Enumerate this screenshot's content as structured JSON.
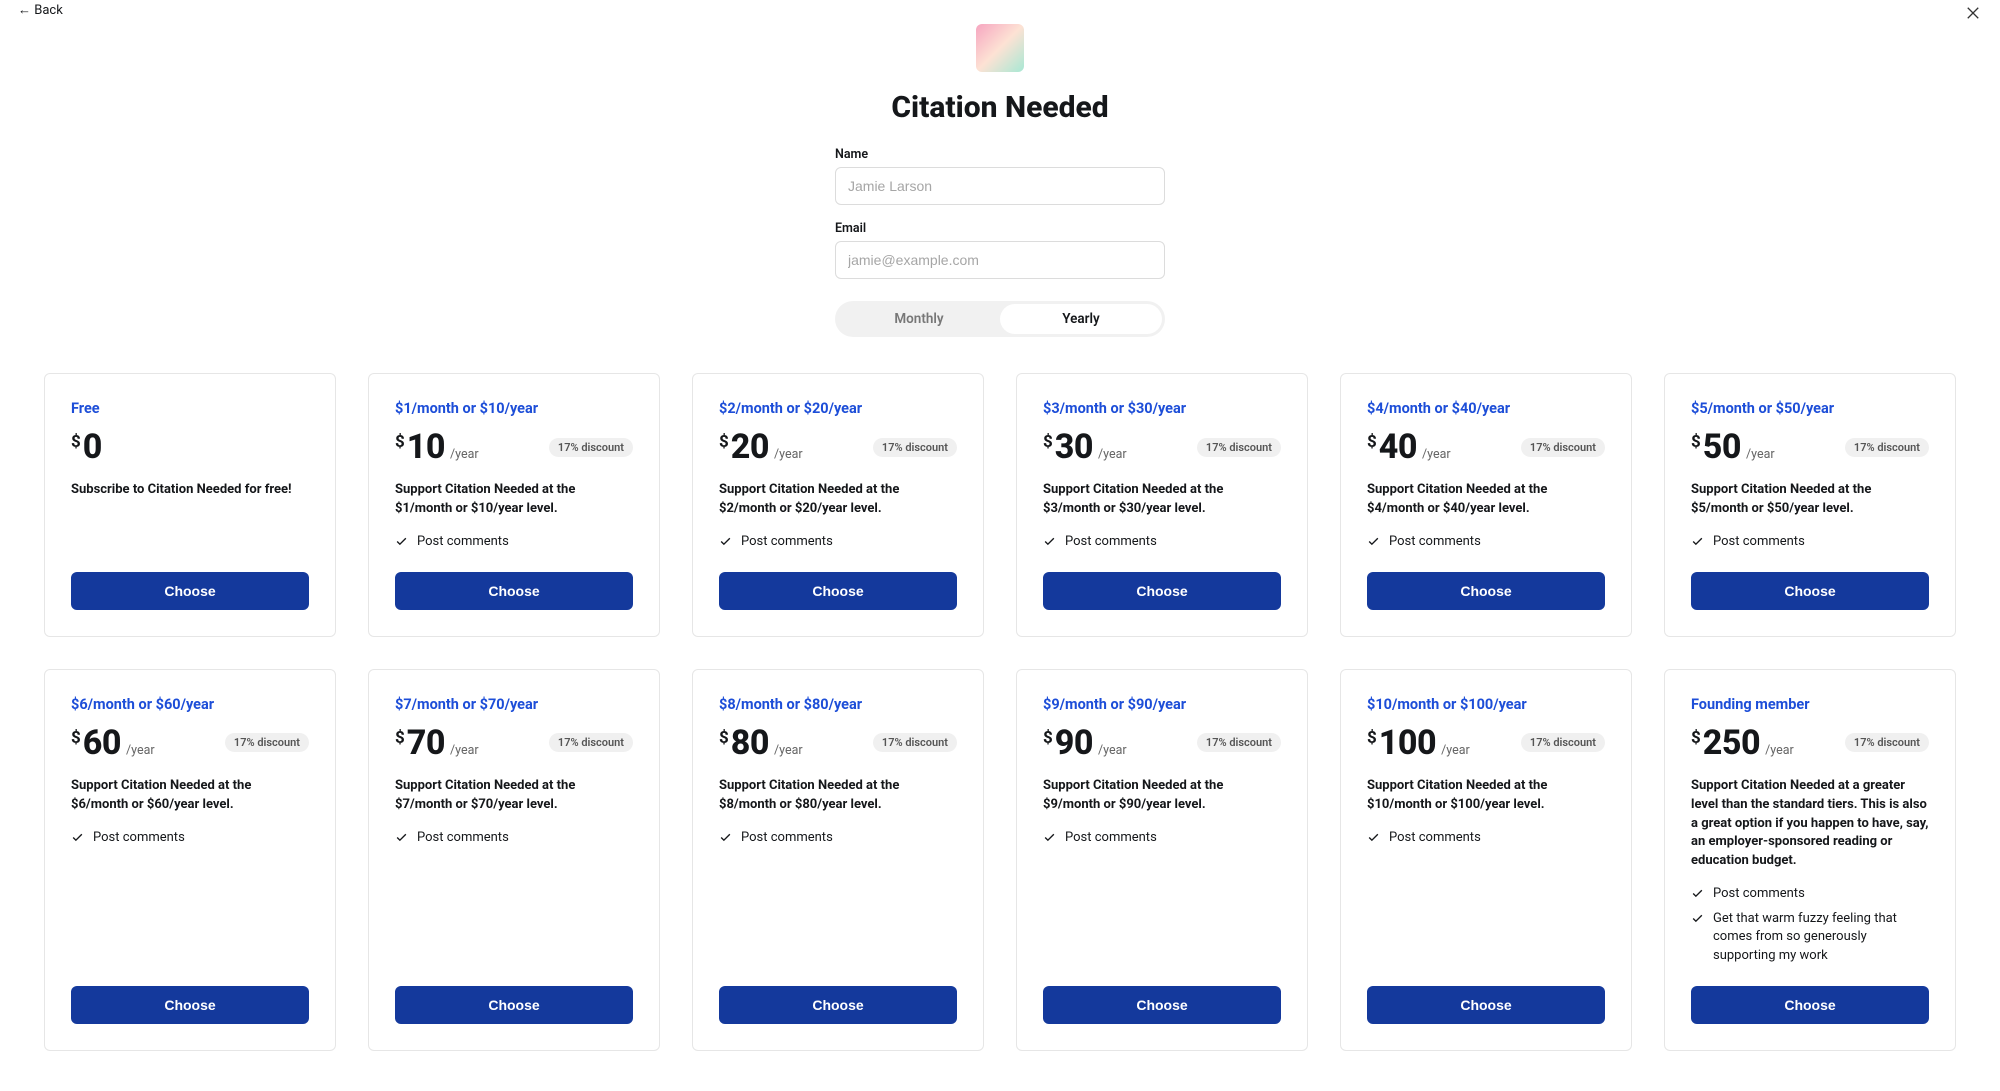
{
  "back_label": "← Back",
  "title": "Citation Needed",
  "form": {
    "name_label": "Name",
    "name_placeholder": "Jamie Larson",
    "email_label": "Email",
    "email_placeholder": "jamie@example.com"
  },
  "toggle": {
    "monthly": "Monthly",
    "yearly": "Yearly"
  },
  "discount_label": "17% discount",
  "choose_label": "Choose",
  "feature_comments": "Post comments",
  "feature_fuzzy": "Get that warm fuzzy feeling that comes from so generously supporting my work",
  "plans": [
    {
      "title": "Free",
      "amount": "0",
      "per": "",
      "discount": false,
      "desc": "Subscribe to Citation Needed for free!",
      "features": []
    },
    {
      "title": "$1/month or $10/year",
      "amount": "10",
      "per": "/year",
      "discount": true,
      "desc": "Support Citation Needed at the $1/month or $10/year level.",
      "features": [
        "comments"
      ]
    },
    {
      "title": "$2/month or $20/year",
      "amount": "20",
      "per": "/year",
      "discount": true,
      "desc": "Support Citation Needed at the $2/month or $20/year level.",
      "features": [
        "comments"
      ]
    },
    {
      "title": "$3/month or $30/year",
      "amount": "30",
      "per": "/year",
      "discount": true,
      "desc": "Support Citation Needed at the $3/month or $30/year level.",
      "features": [
        "comments"
      ]
    },
    {
      "title": "$4/month or $40/year",
      "amount": "40",
      "per": "/year",
      "discount": true,
      "desc": "Support Citation Needed at the $4/month or $40/year level.",
      "features": [
        "comments"
      ]
    },
    {
      "title": "$5/month or $50/year",
      "amount": "50",
      "per": "/year",
      "discount": true,
      "desc": "Support Citation Needed at the $5/month or $50/year level.",
      "features": [
        "comments"
      ]
    },
    {
      "title": "$6/month or $60/year",
      "amount": "60",
      "per": "/year",
      "discount": true,
      "desc": "Support Citation Needed at the $6/month or $60/year level.",
      "features": [
        "comments"
      ]
    },
    {
      "title": "$7/month or $70/year",
      "amount": "70",
      "per": "/year",
      "discount": true,
      "desc": "Support Citation Needed at the $7/month or $70/year level.",
      "features": [
        "comments"
      ]
    },
    {
      "title": "$8/month or $80/year",
      "amount": "80",
      "per": "/year",
      "discount": true,
      "desc": "Support Citation Needed at the $8/month or $80/year level.",
      "features": [
        "comments"
      ]
    },
    {
      "title": "$9/month or $90/year",
      "amount": "90",
      "per": "/year",
      "discount": true,
      "desc": "Support Citation Needed at the $9/month or $90/year level.",
      "features": [
        "comments"
      ]
    },
    {
      "title": "$10/month or $100/year",
      "amount": "100",
      "per": "/year",
      "discount": true,
      "desc": "Support Citation Needed at the $10/month or $100/year level.",
      "features": [
        "comments"
      ]
    },
    {
      "title": "Founding member",
      "amount": "250",
      "per": "/year",
      "discount": true,
      "desc": "Support Citation Needed at a greater level than the standard tiers. This is also a great option if you happen to have, say, an employer-sponsored reading or education budget.",
      "features": [
        "comments",
        "fuzzy"
      ]
    }
  ]
}
